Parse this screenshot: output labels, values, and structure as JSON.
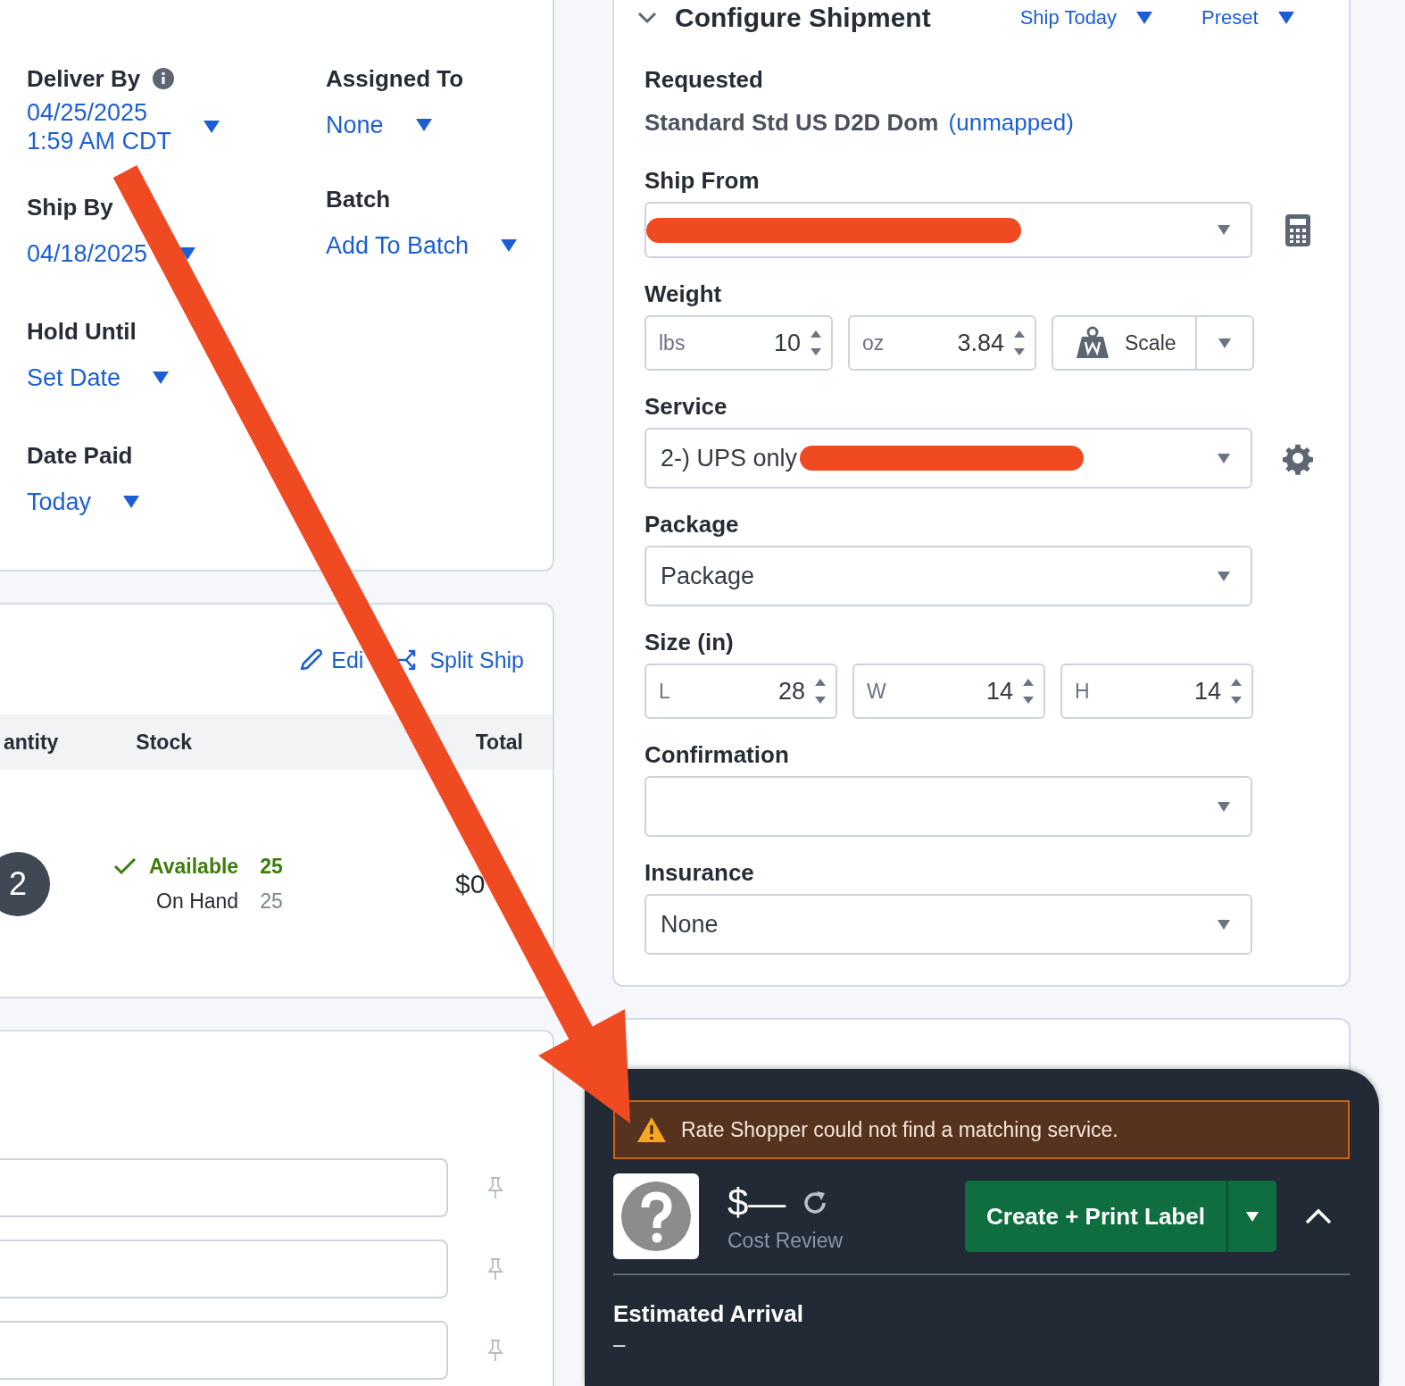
{
  "details": {
    "columns": [
      [
        {
          "label": "Deliver By",
          "info": true,
          "values": [
            "04/25/2025",
            "1:59 AM CDT"
          ]
        },
        {
          "label": "Ship By",
          "info": false,
          "values": [
            "04/18/2025"
          ]
        },
        {
          "label": "Hold Until",
          "info": false,
          "values": [
            "Set Date"
          ]
        },
        {
          "label": "Date Paid",
          "info": false,
          "values": [
            "Today"
          ]
        }
      ],
      [
        {
          "label": "Assigned To",
          "info": false,
          "values": [
            "None"
          ]
        },
        {
          "label": "Batch",
          "info": false,
          "values": [
            "Add To Batch"
          ]
        }
      ]
    ]
  },
  "items": {
    "actions": [
      "Edi",
      "Split Ship"
    ],
    "columns": [
      "antity",
      "Stock",
      "Total"
    ],
    "rows": [
      {
        "quantity": "2",
        "stock": [
          {
            "kind": "available",
            "label": "Available",
            "count": "25"
          },
          {
            "kind": "on_hand",
            "label": "On Hand",
            "count": "25"
          }
        ],
        "total": "$0"
      }
    ]
  },
  "notes": {
    "fields": [
      {
        "kind": "input"
      },
      {
        "kind": "input"
      },
      {
        "kind": "input"
      }
    ]
  },
  "shipment": {
    "title": "Configure Shipment",
    "links": [
      "Ship Today",
      "Preset"
    ],
    "requested": {
      "label": "Requested",
      "service": "Standard Std US D2D Dom",
      "note": "(unmapped)"
    },
    "ship_from": {
      "label": "Ship From",
      "redacted": true
    },
    "weight": {
      "label": "Weight",
      "inputs": [
        {
          "unit": "lbs",
          "value": "10"
        },
        {
          "unit": "oz",
          "value": "3.84"
        }
      ],
      "scale": "Scale"
    },
    "service": {
      "label": "Service",
      "value": "2-) UPS only",
      "redacted": true
    },
    "package": {
      "label": "Package",
      "value": "Package"
    },
    "size": {
      "label": "Size (in)",
      "inputs": [
        {
          "unit": "L",
          "value": "28"
        },
        {
          "unit": "W",
          "value": "14"
        },
        {
          "unit": "H",
          "value": "14"
        }
      ]
    },
    "confirmation": {
      "label": "Confirmation"
    },
    "insurance": {
      "label": "Insurance",
      "value": "None"
    }
  },
  "rate_panel": {
    "warning": "Rate Shopper could not find a matching service.",
    "price": "$—",
    "cost_label": "Cost Review",
    "button": "Create + Print Label",
    "arrival_label": "Estimated Arrival",
    "arrival_value": "–"
  }
}
